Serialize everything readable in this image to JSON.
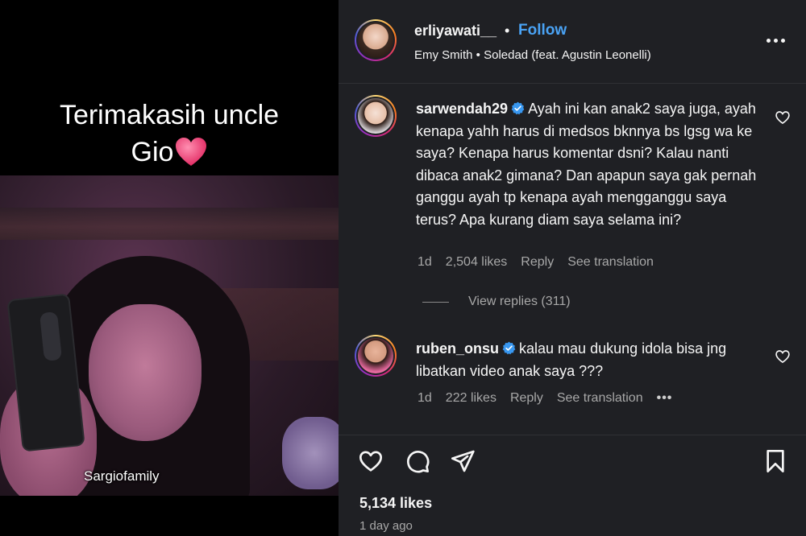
{
  "media": {
    "caption_line1": "Terimakasih uncle",
    "caption_line2": "Gio",
    "watermark": "Sargiofamily"
  },
  "header": {
    "username": "erliyawati__",
    "separator": "•",
    "follow_label": "Follow",
    "audio": "Emy Smith • Soledad (feat. Agustin Leonelli)"
  },
  "comments": [
    {
      "username": "sarwendah29",
      "verified": true,
      "text": "Ayah ini kan anak2 saya juga, ayah kenapa yahh harus di medsos bknnya bs lgsg wa ke saya? Kenapa harus komentar dsni? Kalau nanti dibaca anak2 gimana? Dan apapun saya gak pernah ganggu ayah tp kenapa ayah mengganggu saya terus? Apa kurang diam saya selama ini?",
      "age": "1d",
      "likes": "2,504 likes",
      "reply_label": "Reply",
      "translate_label": "See translation"
    },
    {
      "username": "ruben_onsu",
      "verified": true,
      "text": "kalau mau dukung idola bisa jng libatkan video anak saya ???",
      "age": "1d",
      "likes": "222 likes",
      "reply_label": "Reply",
      "translate_label": "See translation",
      "more": "•••"
    }
  ],
  "view_replies": "View replies (311)",
  "footer": {
    "likes": "5,134 likes",
    "time": "1 day ago"
  },
  "colors": {
    "panel_bg": "#1f2024",
    "accent_follow": "#4aa3f5",
    "verified_badge": "#3897f0",
    "muted_text": "#a8a8a8"
  },
  "icons": [
    "heart-icon",
    "comment-icon",
    "share-icon",
    "bookmark-icon",
    "more-options-icon",
    "verified-badge-icon"
  ]
}
